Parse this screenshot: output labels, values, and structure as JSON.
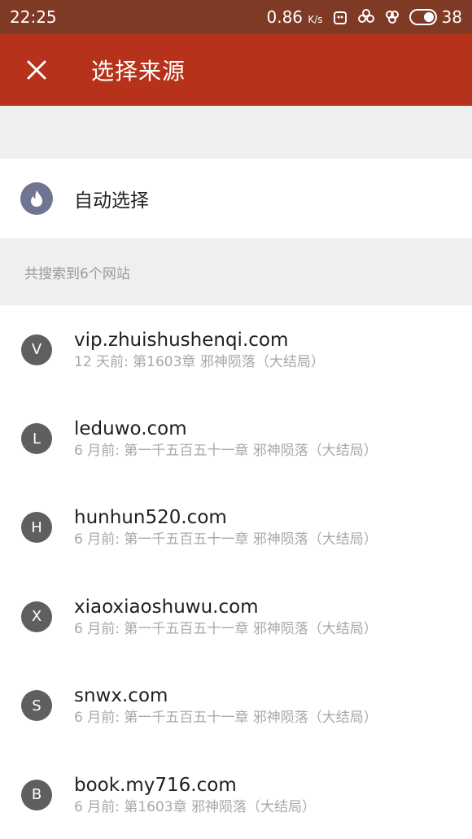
{
  "status_bar": {
    "time": "22:25",
    "speed": "0.86",
    "speed_unit": "K/s",
    "battery": "38"
  },
  "app_bar": {
    "close_icon": "close-icon",
    "title": "选择来源"
  },
  "auto_select": {
    "icon": "flame-icon",
    "label": "自动选择"
  },
  "count_text": "共搜索到6个网站",
  "sites": [
    {
      "letter": "V",
      "domain": "vip.zhuishushenqi.com",
      "latest": "12 天前:  第1603章 邪神陨落（大结局）"
    },
    {
      "letter": "L",
      "domain": "leduwo.com",
      "latest": "6 月前:  第一千五百五十一章 邪神陨落（大结局）"
    },
    {
      "letter": "H",
      "domain": "hunhun520.com",
      "latest": "6 月前:  第一千五百五十一章 邪神陨落（大结局）"
    },
    {
      "letter": "X",
      "domain": "xiaoxiaoshuwu.com",
      "latest": "6 月前:  第一千五百五十一章 邪神陨落（大结局）"
    },
    {
      "letter": "S",
      "domain": "snwx.com",
      "latest": "6 月前:  第一千五百五十一章 邪神陨落（大结局）"
    },
    {
      "letter": "B",
      "domain": "book.my716.com",
      "latest": "6 月前:  第1603章 邪神陨落（大结局）"
    }
  ],
  "colors": {
    "status_bar": "#7e3a24",
    "app_bar": "#b6321b",
    "avatar": "#5f5f5f",
    "flame_circle": "#6f7592"
  }
}
